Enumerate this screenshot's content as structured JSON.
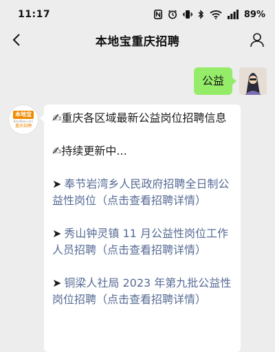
{
  "status_bar": {
    "time": "11:17",
    "battery": "89%",
    "icons": [
      "nfc-icon",
      "alarm-icon",
      "vibrate-icon",
      "bluetooth-icon",
      "wifi-icon",
      "signal-icon"
    ]
  },
  "nav": {
    "title": "本地宝重庆招聘",
    "back_icon": "chevron-left-icon",
    "profile_icon": "user-icon"
  },
  "chat": {
    "outgoing": {
      "text": "公益"
    },
    "incoming": {
      "logo": {
        "top": "本地宝",
        "mid": "Bendibao.com",
        "bottom": "重庆招聘"
      },
      "intro": "✍重庆各区域最新公益岗位招聘信息",
      "update_note": "✍持续更新中...",
      "items": [
        {
          "arrow": "➤",
          "text": "奉节岩湾乡人民政府招聘全日制公益性岗位（点击查看招聘详情）"
        },
        {
          "arrow": "➤",
          "text": "秀山钟灵镇 11 月公益性岗位工作人员招聘（点击查看招聘详情）"
        },
        {
          "arrow": "➤",
          "text": "铜梁人社局 2023 年第九批公益性岗位招聘（点击查看招聘详情）"
        }
      ]
    }
  },
  "colors": {
    "background": "#ededed",
    "outgoing_bubble": "#95ec69",
    "incoming_bubble": "#ffffff",
    "link": "#576b95",
    "logo_orange": "#f08a00"
  }
}
